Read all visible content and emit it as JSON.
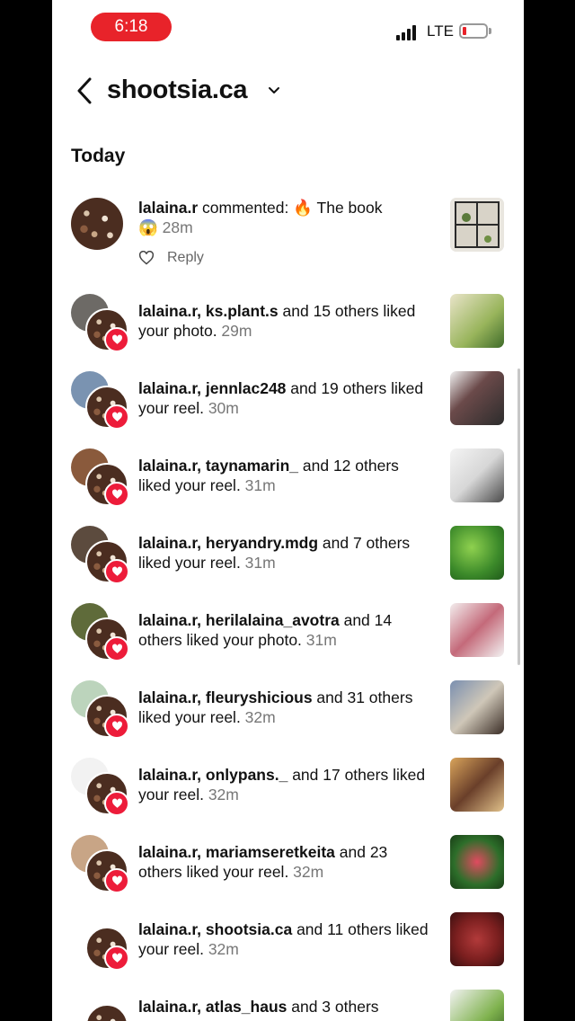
{
  "status_bar": {
    "time": "6:18",
    "network": "LTE"
  },
  "header": {
    "title": "shootsia.ca"
  },
  "section": {
    "title": "Today"
  },
  "comment": {
    "user": "lalaina.r",
    "action": "commented:",
    "text": "🔥 The book",
    "emoji": "😱",
    "time": "28m",
    "reply_label": "Reply"
  },
  "notifications": [
    {
      "users": "lalaina.r, ks.plant.s",
      "tail": " and 15 others liked your photo.",
      "time": "29m"
    },
    {
      "users": "lalaina.r, jennlac248",
      "tail": " and 19 others liked your reel.",
      "time": "30m"
    },
    {
      "users": "lalaina.r, taynamarin_",
      "tail": " and 12 others liked your reel.",
      "time": "31m"
    },
    {
      "users": "lalaina.r, heryandry.mdg",
      "tail": " and 7 others liked your reel.",
      "time": "31m"
    },
    {
      "users": "lalaina.r, herilalaina_avotra",
      "tail": " and 14 others liked your photo.",
      "time": "31m"
    },
    {
      "users": "lalaina.r, fleuryshicious",
      "tail": " and 31 others liked your reel.",
      "time": "32m"
    },
    {
      "users": "lalaina.r, onlypans._",
      "tail": " and 17 others liked your reel.",
      "time": "32m"
    },
    {
      "users": "lalaina.r, mariamseretkeita",
      "tail": " and 23 others liked your reel.",
      "time": "32m"
    },
    {
      "users": "lalaina.r, shootsia.ca",
      "tail": " and 11 others liked your reel.",
      "time": "32m"
    },
    {
      "users": "lalaina.r, atlas_haus",
      "tail": " and 3 others",
      "time": ""
    }
  ],
  "colors": {
    "accent_red": "#ed1c3a",
    "time_pill": "#e8232a"
  },
  "icons": [
    "back-chevron-icon",
    "dropdown-chevron-icon",
    "heart-icon",
    "signal-icon",
    "battery-icon"
  ]
}
